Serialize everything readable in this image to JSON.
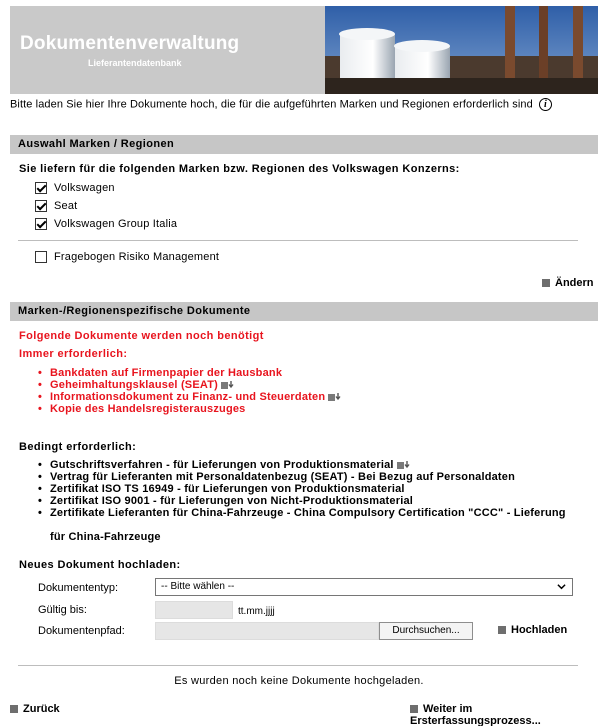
{
  "header": {
    "title": "Dokumentenverwaltung",
    "subtitle": "Lieferantendatenbank"
  },
  "intro": {
    "text": "Bitte laden Sie hier Ihre Dokumente hoch, die für die aufgeführten Marken und Regionen erforderlich sind",
    "info_icon": "info-icon"
  },
  "section1": {
    "title": "Auswahl Marken / Regionen",
    "question": "Sie liefern für die folgenden Marken bzw. Regionen des Volkswagen Konzerns:",
    "brands": [
      {
        "label": "Volkswagen",
        "checked": true
      },
      {
        "label": "Seat",
        "checked": true
      },
      {
        "label": "Volkswagen Group Italia",
        "checked": true
      }
    ],
    "risk_questionnaire": {
      "label": "Fragebogen Risiko Management",
      "checked": false
    },
    "change_link": "Ändern"
  },
  "section2": {
    "title": "Marken-/Regionenspezifische Dokumente",
    "required_heading": "Folgende Dokumente werden noch benötigt",
    "always_heading": "Immer erforderlich:",
    "always_items": [
      "Bankdaten auf Firmenpapier der Hausbank",
      "Geheimhaltungsklausel (SEAT)",
      "Informationsdokument zu Finanz- und Steuerdaten",
      "Kopie des Handelsregisterauszuges"
    ],
    "conditional_heading": "Bedingt erforderlich:",
    "conditional_items": [
      "Gutschriftsverfahren - für Lieferungen von Produktionsmaterial",
      "Vertrag für Lieferanten mit Personaldatenbezug (SEAT) - Bei Bezug auf Personaldaten",
      "Zertifikat ISO TS 16949 - für Lieferungen von Produktionsmaterial",
      "Zertifikat ISO 9001 - für Lieferungen von Nicht-Produktionsmaterial",
      "Zertifikate Lieferanten für China-Fahrzeuge - China Compulsory Certification \"CCC\" - Lieferung",
      "für China-Fahrzeuge"
    ]
  },
  "upload": {
    "heading": "Neues Dokument hochladen:",
    "doctype_label": "Dokumententyp:",
    "doctype_value": "-- Bitte wählen --",
    "valid_label": "Gültig bis:",
    "valid_value": "",
    "date_hint": "tt.mm.jjjj",
    "path_label": "Dokumentenpfad:",
    "path_value": "",
    "browse_label": "Durchsuchen...",
    "upload_link": "Hochladen"
  },
  "status": {
    "no_documents": "Es wurden noch keine Dokumente hochgeladen."
  },
  "footer": {
    "back_link": "Zurück",
    "next_link": "Weiter im Ersterfassungsprozess..."
  },
  "colors": {
    "section_bar": "#c6c6c6",
    "required_red": "#e8141e",
    "header_bg": "#c9c9c9"
  }
}
